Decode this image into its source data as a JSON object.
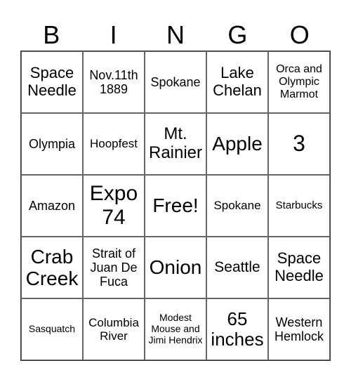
{
  "header": [
    "B",
    "I",
    "N",
    "G",
    "O"
  ],
  "cells": [
    [
      "Space Needle",
      "Nov.11th 1889",
      "Spokane",
      "Lake Chelan",
      "Orca and Olympic Marmot"
    ],
    [
      "Olympia",
      "Hoopfest",
      "Mt. Rainier",
      "Apple",
      "3"
    ],
    [
      "Amazon",
      "Expo 74",
      "Free!",
      "Spokane",
      "Starbucks"
    ],
    [
      "Crab Creek",
      "Strait of Juan De Fuca",
      "Onion",
      "Seattle",
      "Space Needle"
    ],
    [
      "Sasquatch",
      "Columbia River",
      "Modest Mouse and Jimi Hendrix",
      "65 inches",
      "Western Hemlock"
    ]
  ]
}
